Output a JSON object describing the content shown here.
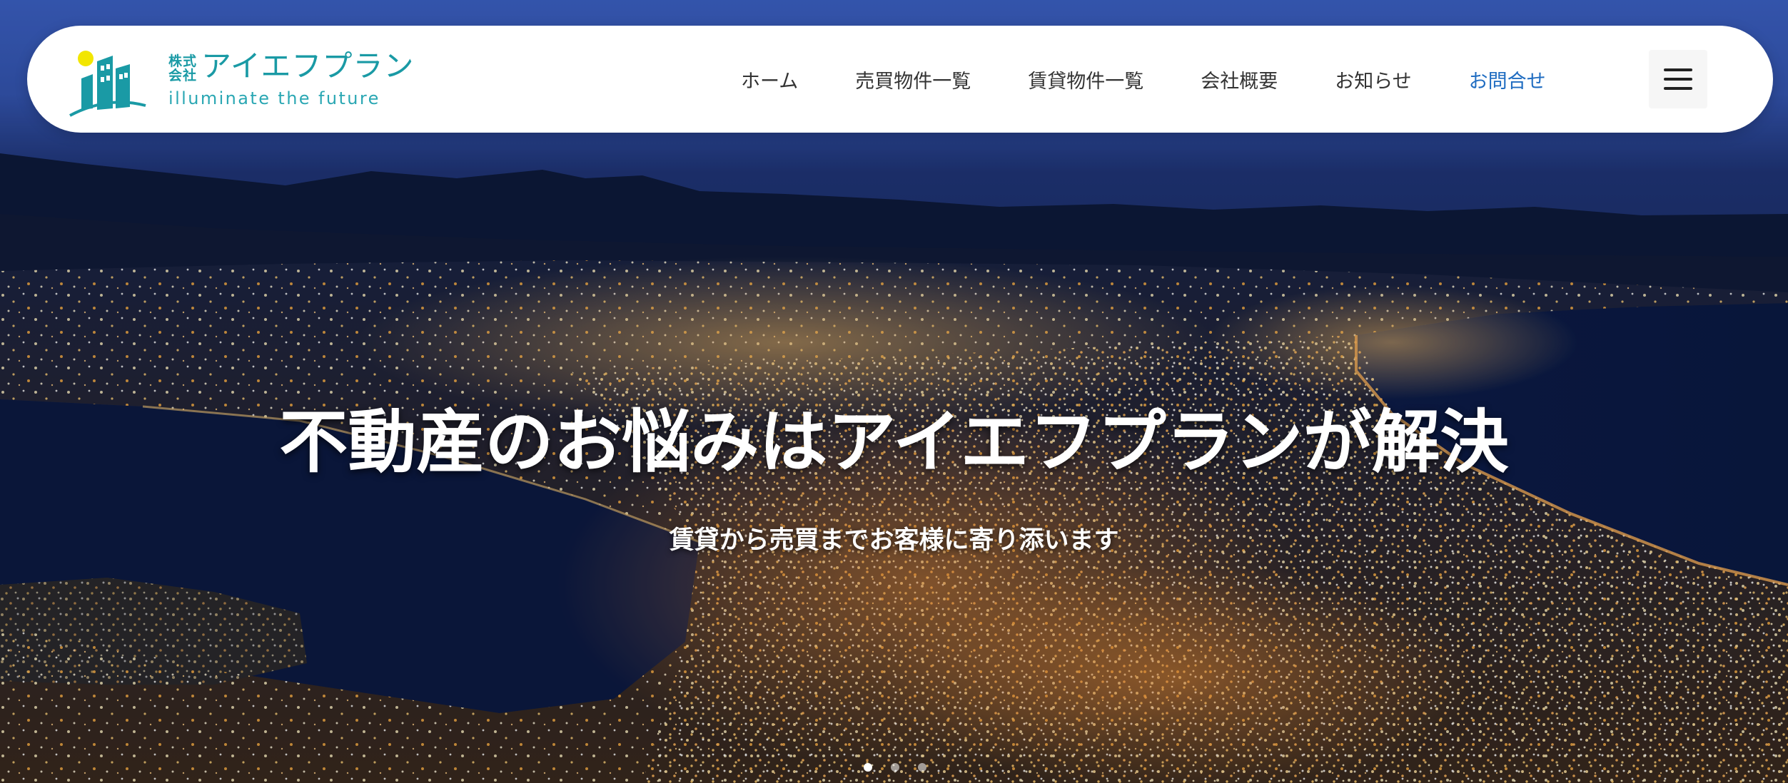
{
  "header": {
    "logo": {
      "company_prefix": "株式会社",
      "company_name": "アイエフプラン",
      "tagline": "illuminate the future"
    },
    "nav": [
      {
        "label": "ホーム"
      },
      {
        "label": "売買物件一覧"
      },
      {
        "label": "賃貸物件一覧"
      },
      {
        "label": "会社概要"
      },
      {
        "label": "お知らせ"
      },
      {
        "label": "お問合せ"
      }
    ],
    "menu_icon": "hamburger-menu-icon"
  },
  "hero": {
    "title": "不動産のお悩みはアイエフプランが解決",
    "subtitle": "賃貸から売買までお客様に寄り添います",
    "slides_total": 3,
    "active_slide": 1
  },
  "colors": {
    "brand_teal": "#1a9aa5",
    "nav_text": "#333333",
    "nav_accent": "#1f6cc1",
    "header_bg": "#ffffff"
  }
}
